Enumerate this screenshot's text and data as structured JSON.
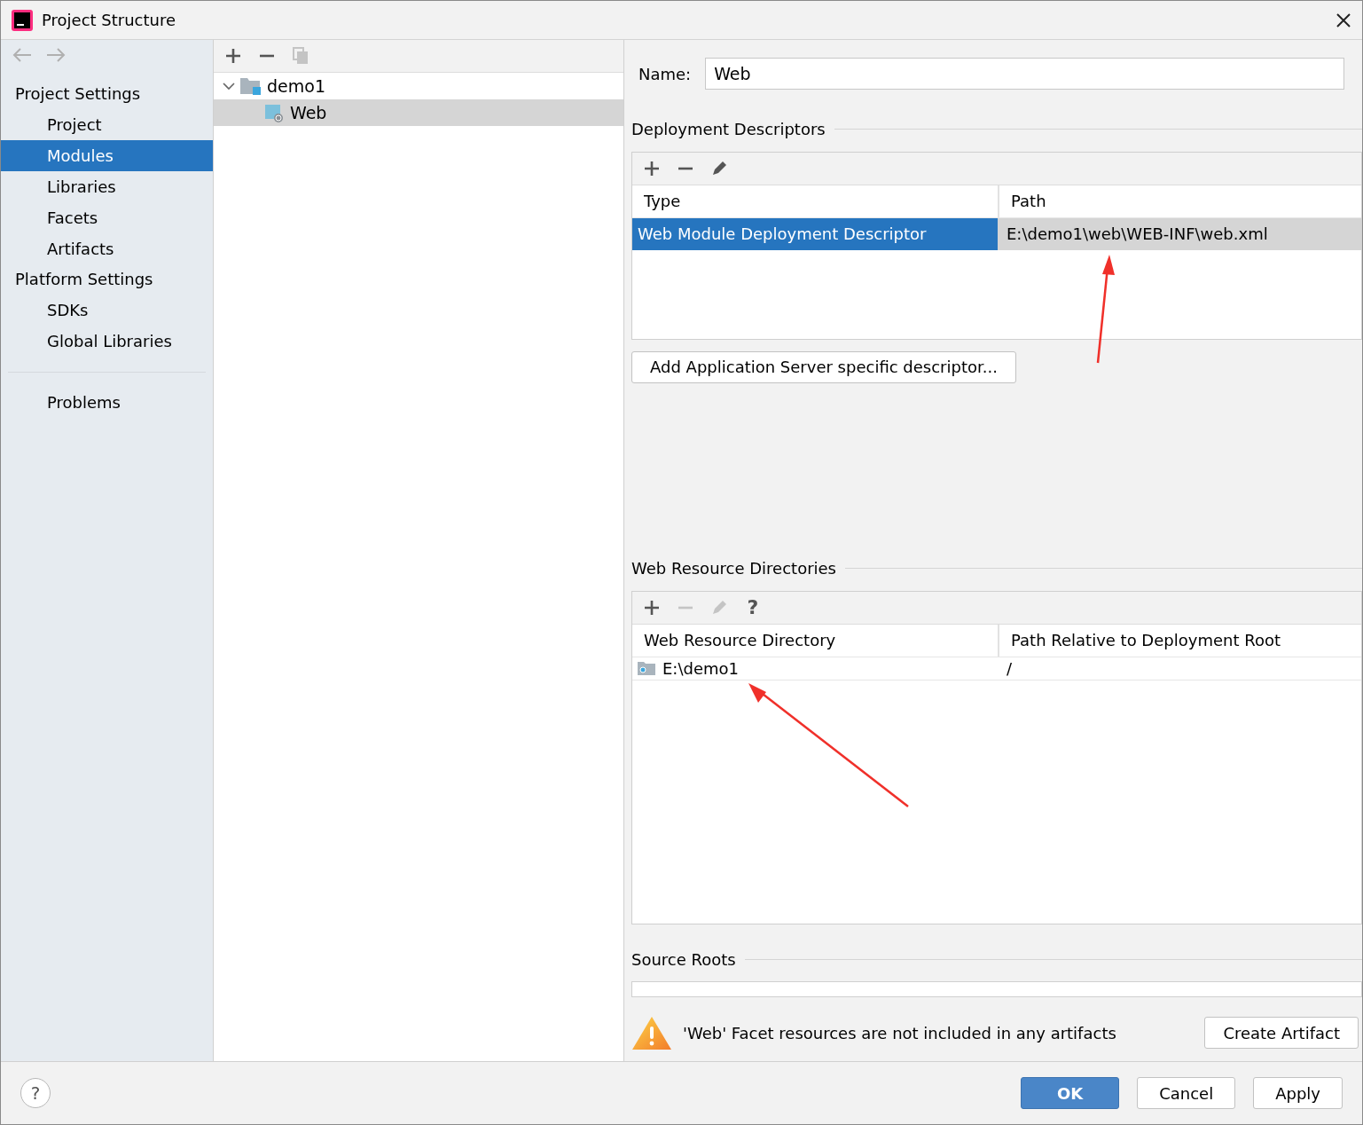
{
  "window": {
    "title": "Project Structure"
  },
  "sidebar": {
    "sections": [
      {
        "title": "Project Settings",
        "items": [
          {
            "label": "Project",
            "selected": false
          },
          {
            "label": "Modules",
            "selected": true
          },
          {
            "label": "Libraries",
            "selected": false
          },
          {
            "label": "Facets",
            "selected": false
          },
          {
            "label": "Artifacts",
            "selected": false
          }
        ]
      },
      {
        "title": "Platform Settings",
        "items": [
          {
            "label": "SDKs",
            "selected": false
          },
          {
            "label": "Global Libraries",
            "selected": false
          }
        ]
      }
    ],
    "extra_items": [
      {
        "label": "Problems",
        "selected": false
      }
    ]
  },
  "module_toolbar": [
    {
      "kind": "add",
      "disabled": false
    },
    {
      "kind": "remove",
      "disabled": false
    },
    {
      "kind": "copy",
      "disabled": true
    }
  ],
  "tree": [
    {
      "label": "demo1",
      "kind": "module",
      "expanded": true,
      "selected": false,
      "children": [
        {
          "label": "Web",
          "kind": "web",
          "selected": true
        }
      ]
    }
  ],
  "name_field": {
    "label": "Name:",
    "value": "Web"
  },
  "deployment_descriptors": {
    "title": "Deployment Descriptors",
    "toolbar": [
      {
        "kind": "add",
        "disabled": false
      },
      {
        "kind": "remove",
        "disabled": false
      },
      {
        "kind": "edit",
        "disabled": false
      }
    ],
    "columns": [
      "Type",
      "Path"
    ],
    "rows": [
      {
        "cells": [
          "Web Module Deployment Descriptor",
          "E:\\demo1\\web\\WEB-INF\\web.xml"
        ],
        "selected": true
      }
    ],
    "add_button": "Add Application Server specific descriptor..."
  },
  "web_resource_directories": {
    "title": "Web Resource Directories",
    "toolbar": [
      {
        "kind": "add",
        "disabled": false
      },
      {
        "kind": "remove",
        "disabled": true
      },
      {
        "kind": "edit",
        "disabled": true
      },
      {
        "kind": "help",
        "disabled": false,
        "label": "?"
      }
    ],
    "columns": [
      "Web Resource Directory",
      "Path Relative to Deployment Root"
    ],
    "rows": [
      {
        "cells": [
          "E:\\demo1",
          "/"
        ],
        "selected": false
      }
    ]
  },
  "source_roots": {
    "title": "Source Roots"
  },
  "warning": {
    "message": "'Web' Facet resources are not included in any artifacts",
    "button": "Create Artifact"
  },
  "footer": {
    "help": "?",
    "buttons": [
      {
        "label": "OK",
        "primary": true
      },
      {
        "label": "Cancel",
        "primary": false
      },
      {
        "label": "Apply",
        "primary": false
      }
    ]
  }
}
